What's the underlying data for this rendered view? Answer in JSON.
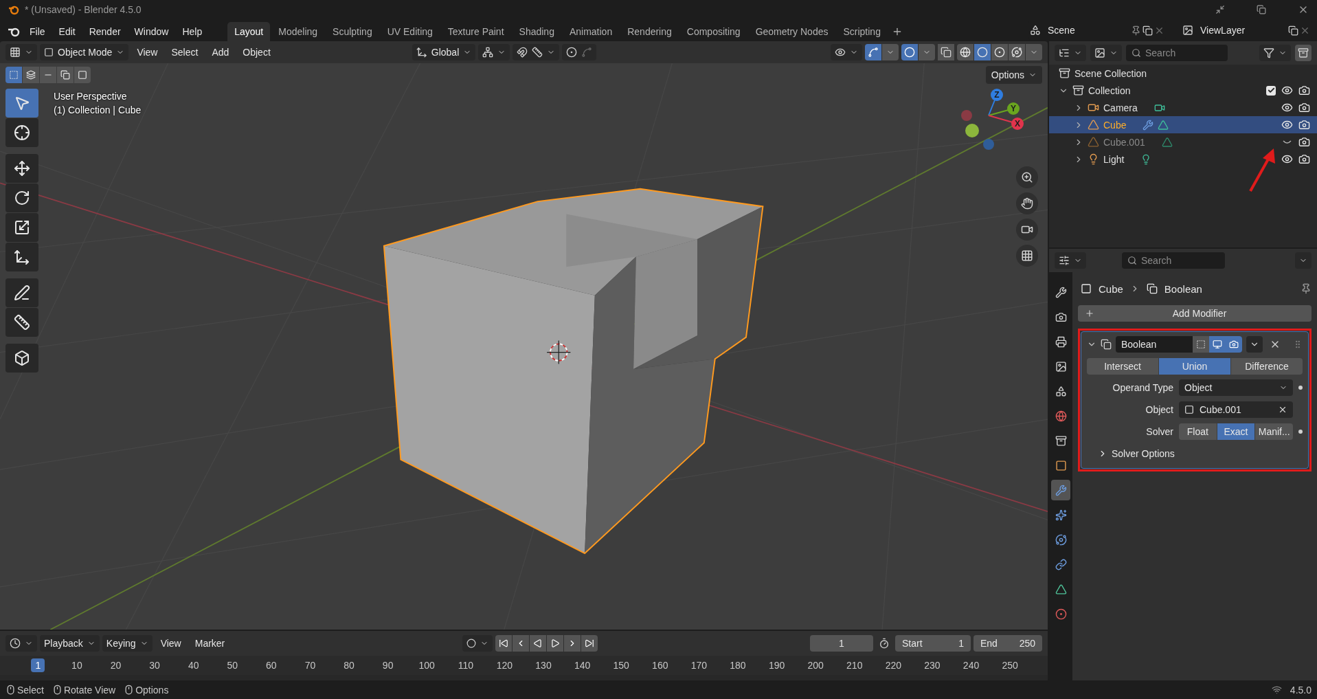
{
  "window": {
    "title": "* (Unsaved) - Blender 4.5.0"
  },
  "menu": [
    "File",
    "Edit",
    "Render",
    "Window",
    "Help"
  ],
  "workspaces": [
    {
      "label": "Layout",
      "selected": true
    },
    {
      "label": "Modeling",
      "selected": false
    },
    {
      "label": "Sculpting",
      "selected": false
    },
    {
      "label": "UV Editing",
      "selected": false
    },
    {
      "label": "Texture Paint",
      "selected": false
    },
    {
      "label": "Shading",
      "selected": false
    },
    {
      "label": "Animation",
      "selected": false
    },
    {
      "label": "Rendering",
      "selected": false
    },
    {
      "label": "Compositing",
      "selected": false
    },
    {
      "label": "Geometry Nodes",
      "selected": false
    },
    {
      "label": "Scripting",
      "selected": false
    }
  ],
  "scene": {
    "value": "Scene"
  },
  "view_layer": {
    "value": "ViewLayer"
  },
  "viewport": {
    "mode": "Object Mode",
    "menus": [
      "View",
      "Select",
      "Add",
      "Object"
    ],
    "orientation": "Global",
    "gizmos_on": true,
    "overlays_on": true,
    "shading": [
      {
        "kind": "wireframe",
        "selected": false
      },
      {
        "kind": "solid",
        "selected": true
      },
      {
        "kind": "material",
        "selected": false
      },
      {
        "kind": "rendered",
        "selected": false
      }
    ],
    "select_modes": [
      {
        "kind": "new",
        "selected": true
      },
      {
        "kind": "extend",
        "selected": false
      },
      {
        "kind": "subtract",
        "selected": false
      },
      {
        "kind": "invert",
        "selected": false
      },
      {
        "kind": "intersect",
        "selected": false
      }
    ],
    "options": "Options",
    "tools": [
      {
        "kind": "select",
        "selected": true
      },
      {
        "kind": "cursor",
        "selected": false
      },
      {
        "kind": "move",
        "selected": false
      },
      {
        "kind": "rotate",
        "selected": false
      },
      {
        "kind": "scale",
        "selected": false
      },
      {
        "kind": "transform",
        "selected": false
      },
      {
        "kind": "annotate",
        "selected": false
      },
      {
        "kind": "measure",
        "selected": false
      },
      {
        "kind": "add_cube",
        "selected": false
      }
    ],
    "overlay_text": [
      "User Perspective",
      "(1) Collection | Cube"
    ],
    "axis_labels": [
      "Z",
      "Y",
      "X"
    ]
  },
  "outliner": {
    "search": {
      "placeholder": "Search"
    },
    "tree": [
      {
        "label": "Scene Collection",
        "kind": "scene_collection",
        "selected": false,
        "children": [
          {
            "label": "Collection",
            "kind": "collection",
            "selected": false,
            "expanded": true,
            "checked": true,
            "visible": true,
            "children": [
              {
                "label": "Camera",
                "kind": "camera",
                "selected": false,
                "expanded": false,
                "visible": true,
                "modifier": false
              },
              {
                "label": "Cube",
                "kind": "mesh",
                "selected": true,
                "expanded": false,
                "visible": true,
                "modifier": true
              },
              {
                "label": "Cube.001",
                "kind": "mesh",
                "selected": false,
                "expanded": false,
                "visible": false,
                "modifier": false
              },
              {
                "label": "Light",
                "kind": "light",
                "selected": false,
                "expanded": false,
                "visible": true,
                "modifier": false
              }
            ]
          }
        ]
      }
    ]
  },
  "properties": {
    "search": {
      "placeholder": "Search"
    },
    "tabs": [
      {
        "kind": "tool",
        "selected": false
      },
      {
        "kind": "render",
        "selected": false
      },
      {
        "kind": "output",
        "selected": false
      },
      {
        "kind": "view_layer",
        "selected": false
      },
      {
        "kind": "scene",
        "selected": false
      },
      {
        "kind": "world",
        "selected": false
      },
      {
        "kind": "collection",
        "selected": false
      },
      {
        "kind": "object",
        "selected": false
      },
      {
        "kind": "modifiers",
        "selected": true
      },
      {
        "kind": "particles",
        "selected": false
      },
      {
        "kind": "physics",
        "selected": false
      },
      {
        "kind": "constraints",
        "selected": false
      },
      {
        "kind": "data",
        "selected": false
      },
      {
        "kind": "material",
        "selected": false
      }
    ],
    "breadcrumb": [
      "Cube",
      "Boolean"
    ],
    "add_modifier": "Add Modifier",
    "modifier": {
      "name": "Boolean",
      "expanded": true,
      "edit_mode": false,
      "viewport": true,
      "render": true,
      "operations": [
        {
          "label": "Intersect",
          "selected": false
        },
        {
          "label": "Union",
          "selected": true
        },
        {
          "label": "Difference",
          "selected": false
        }
      ],
      "fields": [
        {
          "kind": "dropdown",
          "label": "Operand Type",
          "value": "Object"
        },
        {
          "kind": "object",
          "label": "Object",
          "value": "Cube.001"
        },
        {
          "kind": "segmented",
          "label": "Solver",
          "options": [
            {
              "label": "Float",
              "selected": false
            },
            {
              "label": "Exact",
              "selected": true
            },
            {
              "label": "Manif...",
              "selected": false
            }
          ]
        }
      ],
      "subpanel": {
        "label": "Solver Options",
        "expanded": false
      }
    }
  },
  "timeline": {
    "menus": [
      "Playback",
      "Keying",
      "View",
      "Marker"
    ],
    "current_frame": "1",
    "start": {
      "label": "Start",
      "value": "1"
    },
    "end": {
      "label": "End",
      "value": "250"
    },
    "ticks": [
      {
        "label": "1",
        "selected": true
      },
      {
        "label": "10",
        "selected": false
      },
      {
        "label": "20",
        "selected": false
      },
      {
        "label": "30",
        "selected": false
      },
      {
        "label": "40",
        "selected": false
      },
      {
        "label": "50",
        "selected": false
      },
      {
        "label": "60",
        "selected": false
      },
      {
        "label": "70",
        "selected": false
      },
      {
        "label": "80",
        "selected": false
      },
      {
        "label": "90",
        "selected": false
      },
      {
        "label": "100",
        "selected": false
      },
      {
        "label": "110",
        "selected": false
      },
      {
        "label": "120",
        "selected": false
      },
      {
        "label": "130",
        "selected": false
      },
      {
        "label": "140",
        "selected": false
      },
      {
        "label": "150",
        "selected": false
      },
      {
        "label": "160",
        "selected": false
      },
      {
        "label": "170",
        "selected": false
      },
      {
        "label": "180",
        "selected": false
      },
      {
        "label": "190",
        "selected": false
      },
      {
        "label": "200",
        "selected": false
      },
      {
        "label": "210",
        "selected": false
      },
      {
        "label": "220",
        "selected": false
      },
      {
        "label": "230",
        "selected": false
      },
      {
        "label": "240",
        "selected": false
      },
      {
        "label": "250",
        "selected": false
      }
    ]
  },
  "status_bar": {
    "hints": [
      "Select",
      "Rotate View",
      "Options"
    ],
    "version": "4.5.0"
  }
}
